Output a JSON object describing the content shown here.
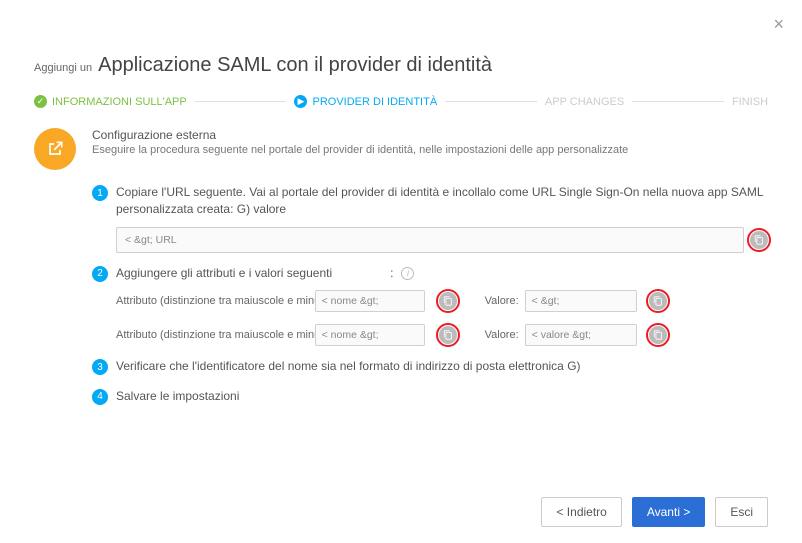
{
  "close_icon": "×",
  "header": {
    "prefix": "Aggiungi un",
    "title": "Applicazione SAML con il provider di identità"
  },
  "stepper": {
    "done_icon": "✓",
    "current_icon": "▶",
    "step1": "INFORMAZIONI SULL'APP",
    "step2": "PROVIDER DI IDENTITÀ",
    "step3": "APP CHANGES",
    "step4": "FINISH"
  },
  "external": {
    "title": "Configurazione esterna",
    "desc": "Eseguire la procedura seguente nel portale del provider di identità, nelle impostazioni delle app personalizzate"
  },
  "step1": {
    "num": "1",
    "text": "Copiare l'URL seguente. Vai al portale del provider di identità e incollalo come URL Single Sign-On nella nuova app SAML personalizzata creata: G) valore",
    "url_value": "< &gt; URL"
  },
  "step2": {
    "num": "2",
    "text": "Aggiungere gli attributi e i valori seguenti",
    "colon": ":",
    "attr_label1": "Attributo (distinzione tra maiuscole e minuscole):",
    "attr_val1": "< nome &gt;",
    "attr_label2": "Attributo (distinzione tra maiuscole e minuscole):",
    "attr_val2": "< nome &gt;",
    "value_label": "Valore:",
    "value_val1": "< &gt;",
    "value_val2": "< valore &gt;"
  },
  "step3": {
    "num": "3",
    "text": "Verificare che l'identificatore del nome sia nel formato di indirizzo di posta elettronica G)"
  },
  "step4": {
    "num": "4",
    "text": "Salvare le impostazioni"
  },
  "footer": {
    "back": "< Indietro",
    "next": "Avanti >",
    "exit": "Esci"
  }
}
